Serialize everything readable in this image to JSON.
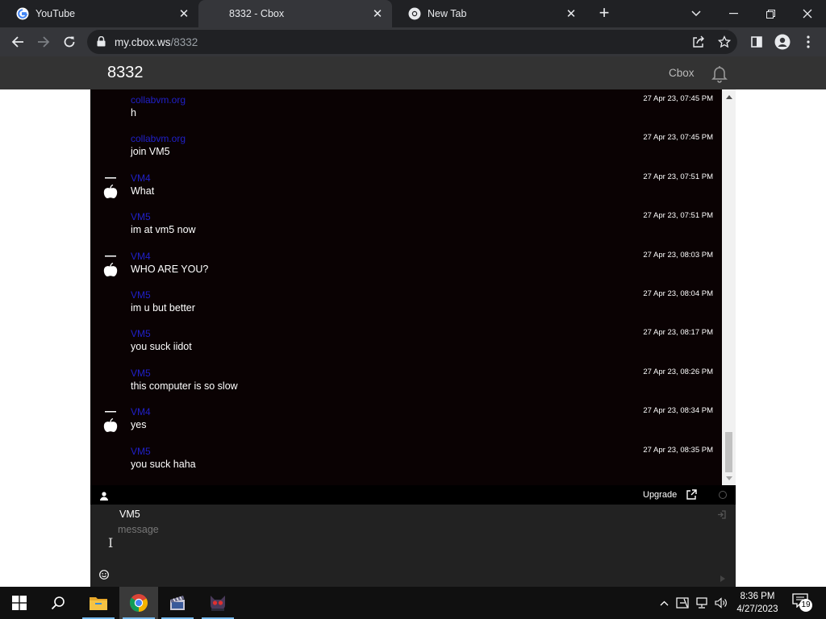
{
  "browser": {
    "tabs": [
      {
        "title": "YouTube",
        "favicon": "google-icon",
        "active": false
      },
      {
        "title": "8332 - Cbox",
        "favicon": "none",
        "active": true
      },
      {
        "title": "New Tab",
        "favicon": "chrome-icon",
        "active": false
      }
    ],
    "url_host": "my.cbox.ws",
    "url_path": "/8332"
  },
  "site": {
    "title": "8332",
    "brand": "Cbox"
  },
  "messages": [
    {
      "author": "collabvm.org",
      "text": "h",
      "time": "27 Apr 23, 07:45 PM",
      "avatar": "none"
    },
    {
      "author": "collabvm.org",
      "text": "join VM5",
      "time": "27 Apr 23, 07:45 PM",
      "avatar": "none"
    },
    {
      "author": "VM4",
      "text": "What",
      "time": "27 Apr 23, 07:51 PM",
      "avatar": "apple-icon"
    },
    {
      "author": "VM5",
      "text": "im at vm5 now",
      "time": "27 Apr 23, 07:51 PM",
      "avatar": "none"
    },
    {
      "author": "VM4",
      "text": "WHO ARE YOU?",
      "time": "27 Apr 23, 08:03 PM",
      "avatar": "apple-icon"
    },
    {
      "author": "VM5",
      "text": "im u but better",
      "time": "27 Apr 23, 08:04 PM",
      "avatar": "none"
    },
    {
      "author": "VM5",
      "text": "you suck iidot",
      "time": "27 Apr 23, 08:17 PM",
      "avatar": "none"
    },
    {
      "author": "VM5",
      "text": "this computer is so slow",
      "time": "27 Apr 23, 08:26 PM",
      "avatar": "none"
    },
    {
      "author": "VM4",
      "text": "yes",
      "time": "27 Apr 23, 08:34 PM",
      "avatar": "apple-icon"
    },
    {
      "author": "VM5",
      "text": "you suck haha",
      "time": "27 Apr 23, 08:35 PM",
      "avatar": "none"
    }
  ],
  "statusbar": {
    "upgrade_label": "Upgrade"
  },
  "compose": {
    "name": "VM5",
    "placeholder": "message"
  },
  "taskbar": {
    "time": "8:36 PM",
    "date": "4/27/2023",
    "notification_count": "19"
  },
  "colors": {
    "author_link": "#2020c8",
    "chat_background": "#0a0203",
    "header_background": "#333333"
  }
}
